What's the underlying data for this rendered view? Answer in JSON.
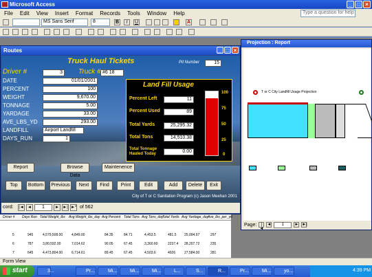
{
  "app": {
    "title": "Microsoft Access",
    "help_placeholder": "Type a question for help"
  },
  "menu": [
    "File",
    "Edit",
    "View",
    "Insert",
    "Format",
    "Records",
    "Tools",
    "Window",
    "Help"
  ],
  "toolbar": {
    "font_name": "MS Sans Serif",
    "font_size": "8"
  },
  "report_window": {
    "title": "Projection : Report",
    "heading": "T or C City Landfill Usage Projection",
    "page_label": "Page:",
    "page_num": "1"
  },
  "form_window": {
    "title": "Routes",
    "heading": "Truck Haul Tickets",
    "pit_number_label": "Pit Number",
    "pit_number": "15",
    "driver_label": "Driver #",
    "driver_value": "3",
    "truck_label": "Truck #",
    "truck_value": "#6 18",
    "fields": [
      {
        "label": "DATE",
        "value": "01/01/2001"
      },
      {
        "label": "PERCENT",
        "value": "100"
      },
      {
        "label": "WEIGHT",
        "value": "9,670.00"
      },
      {
        "label": "TONNAGE",
        "value": "5.00"
      },
      {
        "label": "YARDAGE",
        "value": "33.00"
      },
      {
        "label": "AVE_LBS_YD",
        "value": "293.00"
      },
      {
        "label": "LANDFILL",
        "value": "Airport Landfill"
      },
      {
        "label": "DAYS_RUN",
        "value": "1"
      }
    ],
    "panel": {
      "title": "Land Fill Usage",
      "rows": [
        {
          "label": "Percent Left",
          "value": "11"
        },
        {
          "label": "Percent Used",
          "value": "89"
        },
        {
          "label": "Total Yards",
          "value": "25,295.32"
        },
        {
          "label": "Total Tons",
          "value": "14,510.38"
        },
        {
          "label": "Total Tonnage Hauled Today",
          "value": "0.00"
        }
      ],
      "gauge_ticks": [
        "100",
        "75",
        "50",
        "25",
        "0"
      ],
      "fill_fraction": 0.89
    },
    "side_buttons": [
      "Report",
      "Browse Data",
      "Maintenence"
    ],
    "nav_buttons": [
      "Top",
      "Bottom",
      "Previous",
      "Next",
      "Find",
      "Print",
      "Edit",
      "Add",
      "Delete",
      "Exit"
    ],
    "credit": "City of T or C Sanitation Program (c) Jason Meehan 2001",
    "record_label": "cord:",
    "record_num": "1",
    "record_total": "of 562"
  },
  "grid": {
    "headers": [
      "Driver #",
      "Days Run",
      "Total Weight_lbs",
      "Avg Weight_lbs_day",
      "Avg Percent",
      "Total Tons",
      "Avg Tons_day",
      "Total Yards",
      "Avg Yardage_day",
      "Ave_lbs_per_yd"
    ],
    "rows": [
      [
        "5",
        "945",
        "4,579,508.00",
        "4,849.00",
        "84.35",
        "84.71",
        "4,453.5",
        "481.5",
        "25,094.97",
        "297"
      ],
      [
        "6",
        "787",
        "3,80,592.00",
        "7,014.62",
        "90.05",
        "67.45",
        "3,360.60",
        "2237.4",
        "28,207.72",
        "235"
      ],
      [
        "7",
        "645",
        "4,473,804.00",
        "6,714.61",
        "89.45",
        "67.45",
        "4,503.6",
        "4926",
        "27,584.00",
        "281"
      ]
    ]
  },
  "status": "Form View",
  "taskbar": {
    "start": "start",
    "tasks": [
      "3...",
      "Pr...",
      "Mi...",
      "Mi...",
      "Mi...",
      "L...",
      "S...",
      "R...",
      "Pr...",
      "Mi...",
      "yo..."
    ],
    "time": "4:39 PM"
  },
  "colors": {
    "title_blue": "#1d4bc6",
    "gauge_red": "#e00000",
    "panel_yellow": "#ffd700"
  }
}
